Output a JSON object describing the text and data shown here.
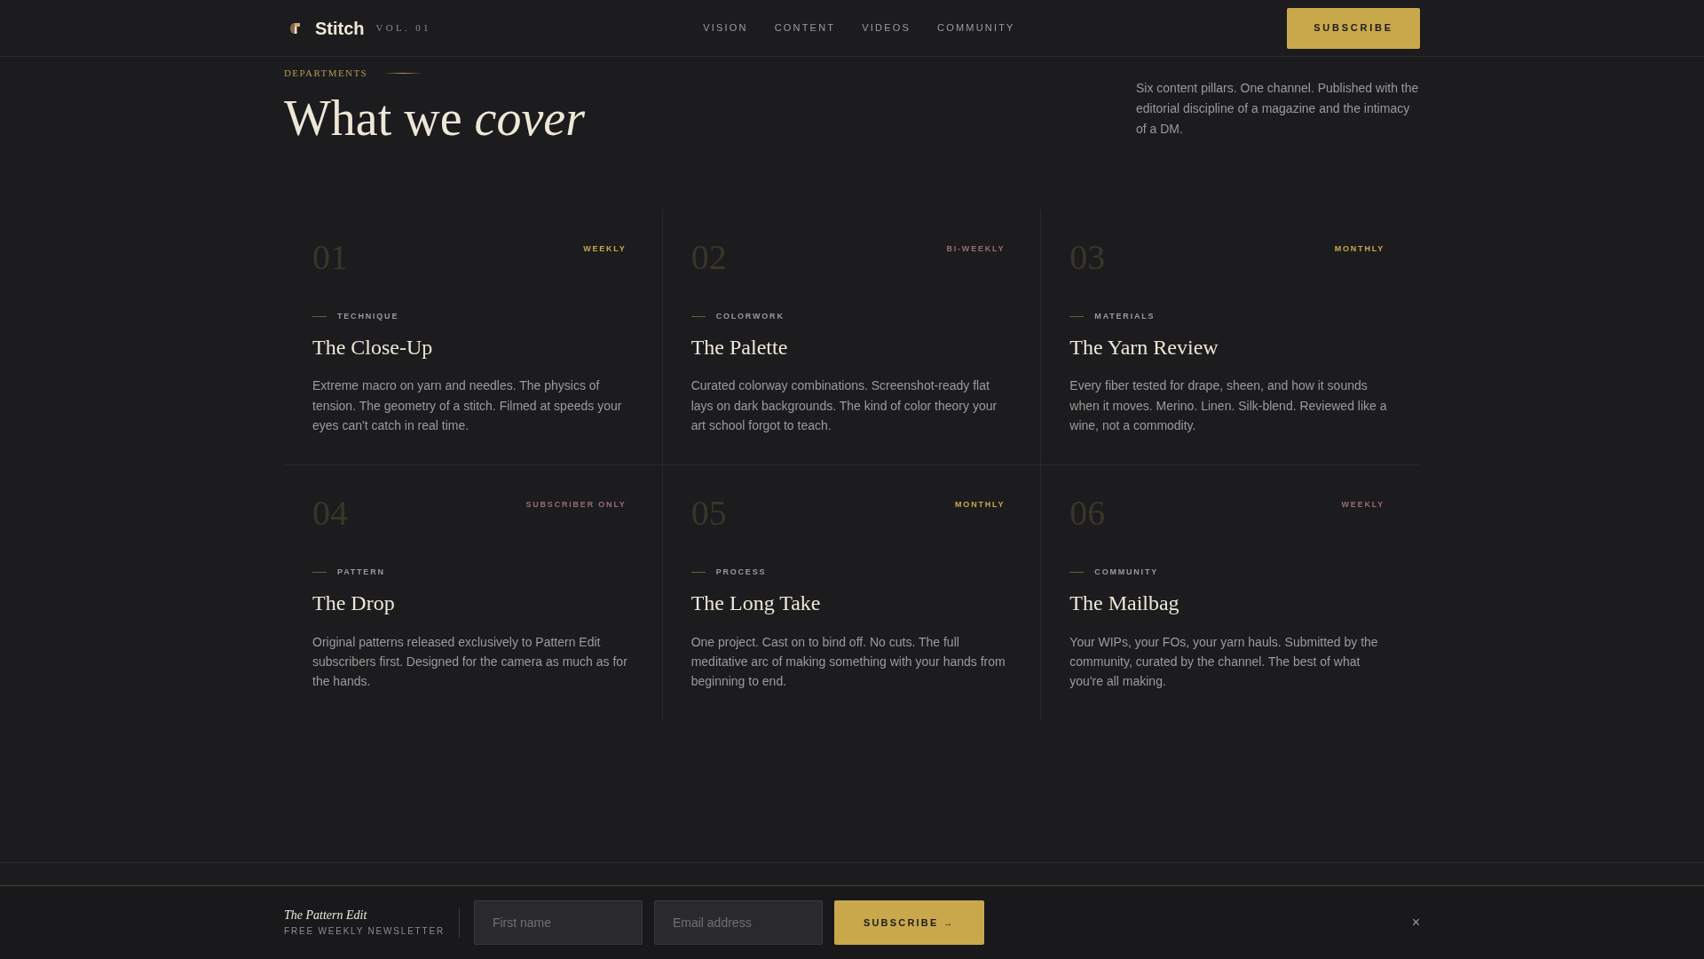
{
  "header": {
    "brand": "Stitch",
    "volume": "VOL. 01",
    "nav": [
      "VISION",
      "CONTENT",
      "VIDEOS",
      "COMMUNITY"
    ],
    "button": "SUBSCRIBE"
  },
  "intro": {
    "eyebrow": "DEPARTMENTS",
    "heading": "What we *cover*",
    "description": "Six content pillars. One channel. Published with the editorial discipline of a magazine and the intimacy of a DM."
  },
  "departments": [
    {
      "number": "01",
      "frequency": "WEEKLY",
      "color": "#c9a84c",
      "category": "TECHNIQUE",
      "title": "The Close-Up",
      "description": "Extreme macro on yarn and needles. The physics of tension. The geometry of a stitch. Filmed at speeds your eyes can't catch in real time."
    },
    {
      "number": "02",
      "frequency": "BI-WEEKLY",
      "color": "#9c6b76",
      "category": "COLORWORK",
      "title": "The Palette",
      "description": "Curated colorway combinations. Screenshot-ready flat lays on dark backgrounds. The kind of color theory your art school forgot to teach."
    },
    {
      "number": "03",
      "frequency": "MONTHLY",
      "color": "#c9a84c",
      "category": "MATERIALS",
      "title": "The Yarn Review",
      "description": "Every fiber tested for drape, sheen, and how it sounds when it moves. Merino. Linen. Silk-blend. Reviewed like a wine, not a commodity."
    },
    {
      "number": "04",
      "frequency": "SUBSCRIBER ONLY",
      "color": "#9c6b76",
      "category": "PATTERN",
      "title": "The Drop",
      "description": "Original patterns released exclusively to Pattern Edit subscribers first. Designed for the camera as much as for the hands."
    },
    {
      "number": "05",
      "frequency": "MONTHLY",
      "color": "#c9a84c",
      "category": "PROCESS",
      "title": "The Long Take",
      "description": "One project. Cast on to bind off. No cuts. The full meditative arc of making something with your hands from beginning to end."
    },
    {
      "number": "06",
      "frequency": "WEEKLY",
      "color": "#9c6b76",
      "category": "COMMUNITY",
      "title": "The Mailbag",
      "description": "Your WIPs, your FOs, your yarn hauls. Submitted by the community, curated by the channel. The best of what you're all making."
    }
  ],
  "newsletter": {
    "title": "The Pattern Edit",
    "subtitle": "FREE WEEKLY NEWSLETTER",
    "fields": [
      {
        "placeholder": "First name"
      },
      {
        "placeholder": "Email address"
      }
    ],
    "button": "SUBSCRIBE →",
    "close": "×"
  }
}
